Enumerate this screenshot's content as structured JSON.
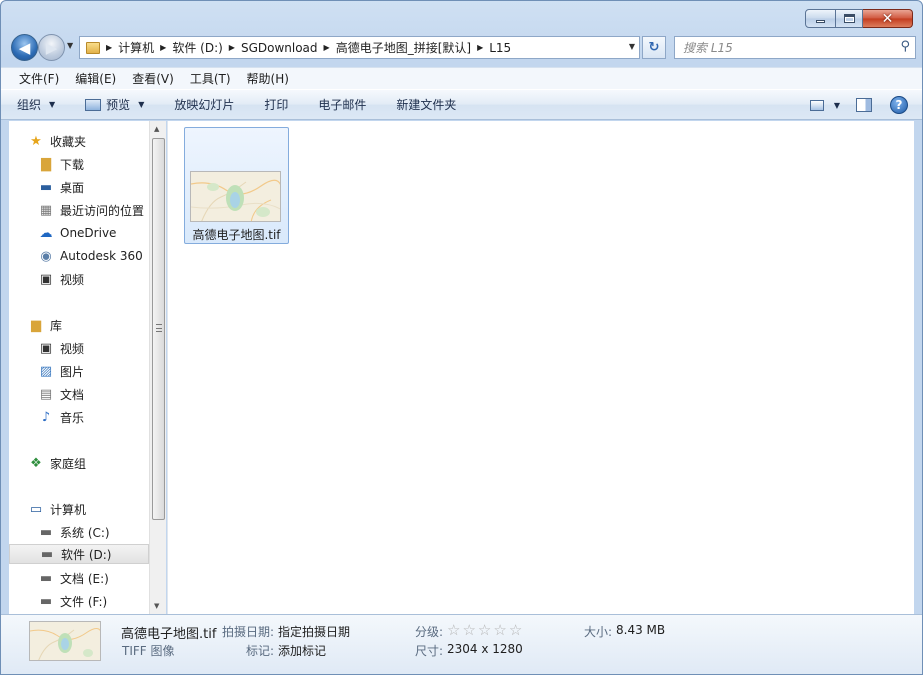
{
  "window": {
    "colors": {
      "accent": "#2d6cb5",
      "close": "#c33c1f"
    }
  },
  "address": {
    "segments": [
      "计算机",
      "软件 (D:)",
      "SGDownload",
      "高德电子地图_拼接[默认]",
      "L15"
    ]
  },
  "search": {
    "placeholder": "搜索 L15"
  },
  "menu": [
    "文件(F)",
    "编辑(E)",
    "查看(V)",
    "工具(T)",
    "帮助(H)"
  ],
  "toolbar": {
    "organize": "组织",
    "preview": "预览",
    "slideshow": "放映幻灯片",
    "print": "打印",
    "email": "电子邮件",
    "new_folder": "新建文件夹"
  },
  "sidebar": {
    "favorites": "收藏夹",
    "fav_items": [
      "下载",
      "桌面",
      "最近访问的位置",
      "OneDrive",
      "Autodesk 360",
      "视频"
    ],
    "libraries": "库",
    "lib_items": [
      "视频",
      "图片",
      "文档",
      "音乐"
    ],
    "homegroup": "家庭组",
    "computer": "计算机",
    "drives": [
      "系统 (C:)",
      "软件 (D:)",
      "文档 (E:)",
      "文件 (F:)"
    ]
  },
  "files": [
    {
      "name": "高德电子地图.tif"
    }
  ],
  "details": {
    "name": "高德电子地图.tif",
    "type": "TIFF 图像",
    "date_key": "拍摄日期:",
    "date_val": "指定拍摄日期",
    "tag_key": "标记:",
    "tag_val": "添加标记",
    "rating_key": "分级:",
    "rating": 0,
    "rating_max": 5,
    "size_key": "大小:",
    "size_val": "8.43 MB",
    "dims_key": "尺寸:",
    "dims_val": "2304 x 1280"
  }
}
